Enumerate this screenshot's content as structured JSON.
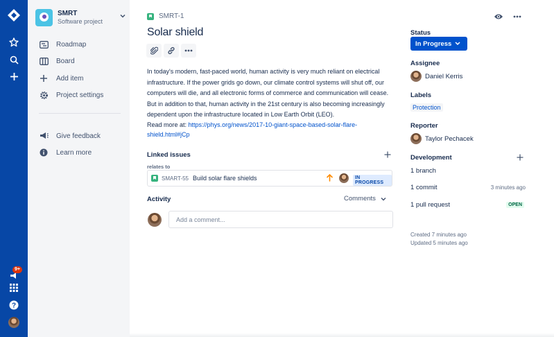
{
  "project": {
    "name": "SMRT",
    "type": "Software project"
  },
  "sidebar": {
    "items": [
      {
        "label": "Roadmap",
        "icon": "roadmap-icon"
      },
      {
        "label": "Board",
        "icon": "board-icon"
      },
      {
        "label": "Add item",
        "icon": "add-item-icon"
      },
      {
        "label": "Project settings",
        "icon": "gear-icon"
      }
    ],
    "secondary": [
      {
        "label": "Give feedback",
        "icon": "megaphone-icon"
      },
      {
        "label": "Learn more",
        "icon": "info-icon"
      }
    ]
  },
  "global_nav": {
    "notifications_badge": "9+"
  },
  "issue": {
    "key": "SMRT-1",
    "title": "Solar shield",
    "description": "In today's modern, fast-paced world, human activity is very much reliant on electrical infrastructure. If the power grids go down, our climate control systems will shut off, our computers will die, and all electronic forms of commerce and communication will cease. But in addition to that, human activity in the 21st century is also becoming increasingly dependent upon the infrastructure located in Low Earth Orbit (LEO).",
    "read_more_label": "Read more at:",
    "read_more_link": "https://phys.org/news/2017-10-giant-space-based-solar-flare-shield.html#jCp"
  },
  "linked_issues": {
    "heading": "Linked issues",
    "relation": "relates to",
    "items": [
      {
        "key": "SMART-55",
        "summary": "Build solar flare shields",
        "status": "IN PROGRESS"
      }
    ]
  },
  "activity": {
    "heading": "Activity",
    "filter": "Comments",
    "comment_placeholder": "Add a comment..."
  },
  "details": {
    "status_label": "Status",
    "status_value": "In Progress",
    "assignee_label": "Assignee",
    "assignee": "Daniel Kerris",
    "labels_label": "Labels",
    "label_value": "Protection",
    "reporter_label": "Reporter",
    "reporter": "Taylor Pechacek",
    "development_label": "Development",
    "dev_branch": "1 branch",
    "dev_commit": "1 commit",
    "dev_commit_time": "3 minutes ago",
    "dev_pr": "1 pull request",
    "dev_pr_status": "OPEN",
    "created": "Created 7 minutes ago",
    "updated": "Updated 5 minutes ago"
  },
  "colors": {
    "nav": "#0747a6",
    "primary": "#0052cc",
    "story": "#36b37e",
    "priority": "#ff8b00"
  }
}
